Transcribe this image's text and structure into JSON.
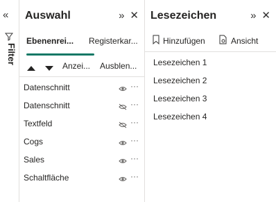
{
  "filter_pane": {
    "collapse_icon": "double-chevron-left",
    "label": "Filter"
  },
  "selection_pane": {
    "title": "Auswahl",
    "tabs": [
      {
        "label": "Ebenenrei...",
        "active": true
      },
      {
        "label": "Registerkar...",
        "active": false
      }
    ],
    "toolbar": {
      "show_label": "Anzei...",
      "hide_label": "Ausblen..."
    },
    "items": [
      {
        "label": "Datenschnitt",
        "visible": true
      },
      {
        "label": "Datenschnitt",
        "visible": false
      },
      {
        "label": "Textfeld",
        "visible": false
      },
      {
        "label": "Cogs",
        "visible": true
      },
      {
        "label": "Sales",
        "visible": true
      },
      {
        "label": "Schaltfläche",
        "visible": true
      }
    ],
    "more_glyph": "···"
  },
  "bookmarks_pane": {
    "title": "Lesezeichen",
    "add_label": "Hinzufügen",
    "view_label": "Ansicht",
    "items": [
      "Lesezeichen 1",
      "Lesezeichen 2",
      "Lesezeichen 3",
      "Lesezeichen 4"
    ]
  },
  "glyphs": {
    "expand": "»",
    "close": "✕",
    "collapse": "«"
  },
  "colors": {
    "accent": "#117865",
    "border": "#e1dfdd",
    "text": "#252423"
  }
}
